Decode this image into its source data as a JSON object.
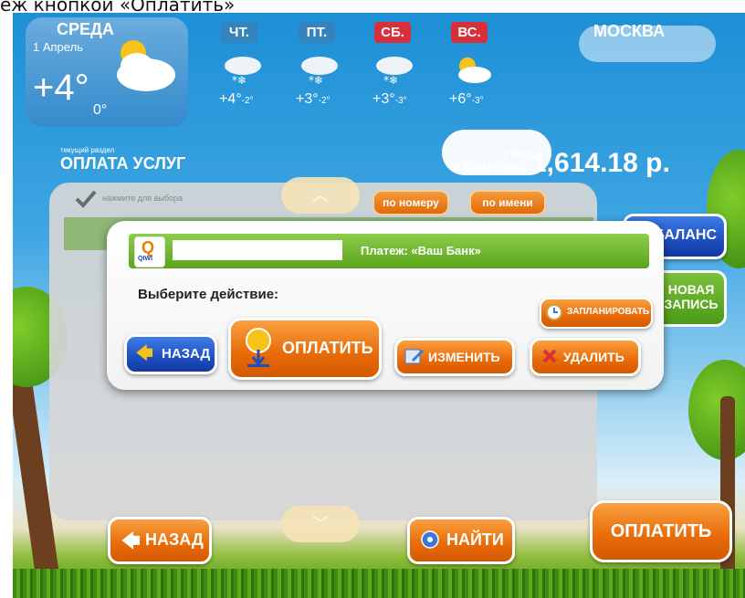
{
  "caption": "еж кнопкой «Оплатить»",
  "weather": {
    "today": {
      "day": "СРЕДА",
      "date": "1 Апрель",
      "temp": "+4°",
      "night": "0°"
    },
    "forecast": [
      {
        "day": "ЧТ.",
        "temp": "+4°",
        "night": "-2°",
        "weekend": false
      },
      {
        "day": "ПТ.",
        "temp": "+3°",
        "night": "-2°",
        "weekend": false
      },
      {
        "day": "СБ.",
        "temp": "+3°",
        "night": "-3°",
        "weekend": true
      },
      {
        "day": "ВС.",
        "temp": "+6°",
        "night": "-3°",
        "weekend": true
      }
    ],
    "city": "МОСКВА"
  },
  "section": {
    "caption": "текущий раздел",
    "title": "ОПЛАТА УСЛУГ"
  },
  "wallet": {
    "label_top": "У ВАС",
    "label_bottom": "В КОШЕЛЬКЕ:",
    "amount": "1,614.18 р."
  },
  "list": {
    "hint": "нажмите для выбора",
    "sort_by_number": "по номеру",
    "sort_by_name": "по имени"
  },
  "side": {
    "balance": "БАЛАНС",
    "new_record": "НОВАЯ ЗАПИСЬ"
  },
  "dialog": {
    "provider_logo": "QIWI",
    "payment_title": "Платеж: «Ваш Банк»",
    "prompt": "Выберите действие:",
    "schedule": "ЗАПЛАНИРОВАТЬ",
    "back": "НАЗАД",
    "pay": "ОПЛАТИТЬ",
    "edit": "ИЗМЕНИТЬ",
    "delete": "УДАЛИТЬ"
  },
  "bottom": {
    "back": "НАЗАД",
    "find": "НАЙТИ",
    "pay": "ОПЛАТИТЬ"
  },
  "colors": {
    "orange": "#e86a08",
    "blue": "#1d4fc0",
    "green": "#5aa51c",
    "weekend_red": "#d8303a"
  }
}
